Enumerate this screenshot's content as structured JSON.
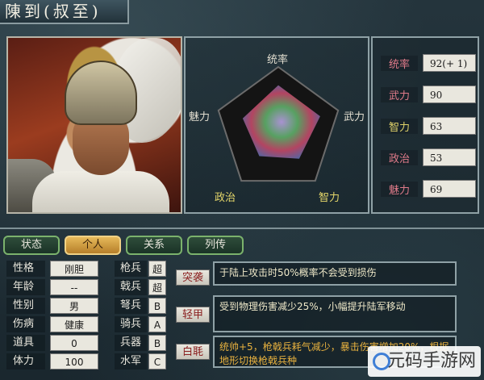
{
  "title": "陳到(叔至)",
  "radar": {
    "labels": [
      "统率",
      "武力",
      "智力",
      "政治",
      "魅力"
    ],
    "values": [
      92,
      90,
      63,
      53,
      69
    ],
    "max": 100
  },
  "stats": [
    {
      "label": "统率",
      "value": "92(+ 1)"
    },
    {
      "label": "武力",
      "value": "90"
    },
    {
      "label": "智力",
      "value": "63"
    },
    {
      "label": "政治",
      "value": "53"
    },
    {
      "label": "魅力",
      "value": "69"
    }
  ],
  "tabs": [
    "状态",
    "个人",
    "关系",
    "列传"
  ],
  "active_tab": "个人",
  "attributes": [
    {
      "key": "性格",
      "value": "刚胆"
    },
    {
      "key": "年龄",
      "value": "--"
    },
    {
      "key": "性别",
      "value": "男"
    },
    {
      "key": "伤病",
      "value": "健康"
    },
    {
      "key": "道具",
      "value": "0"
    },
    {
      "key": "体力",
      "value": "100"
    }
  ],
  "troops": [
    {
      "key": "枪兵",
      "value": "超"
    },
    {
      "key": "戟兵",
      "value": "超"
    },
    {
      "key": "弩兵",
      "value": "B"
    },
    {
      "key": "骑兵",
      "value": "A"
    },
    {
      "key": "兵器",
      "value": "B"
    },
    {
      "key": "水军",
      "value": "C"
    }
  ],
  "skills": [
    {
      "name": "突袭",
      "desc": "于陆上攻击时50%概率不会受到损伤"
    },
    {
      "name": "轻甲",
      "desc": "受到物理伤害减少25%，小幅提升陆军移动"
    },
    {
      "name": "白毦",
      "desc": "统帅+5，枪戟兵耗气减少，暴击伤害增加20%，根据地形切换枪戟兵种"
    }
  ],
  "watermark": "元码手游网",
  "colors": {
    "accent_tab": "#e6b95a",
    "tab_border": "#7bb26c",
    "stat_label_red": "#e07b8a",
    "stat_label_gold": "#e0d36a"
  }
}
